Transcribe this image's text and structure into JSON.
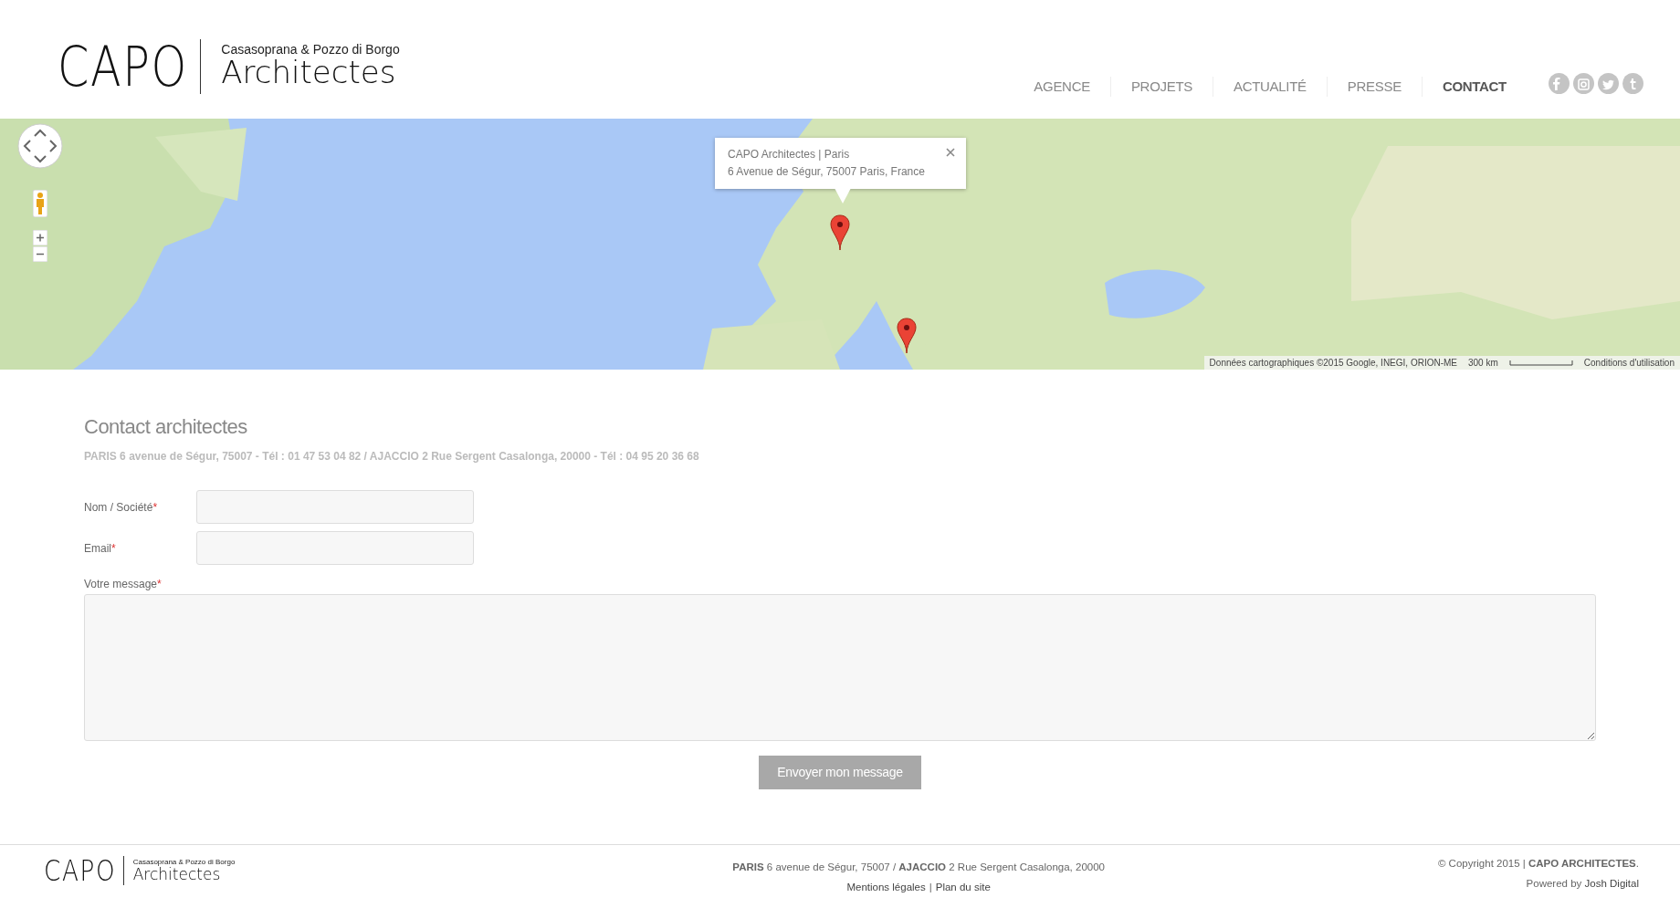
{
  "header": {
    "logo": {
      "mark": "CAPO",
      "subtitle": "Casasoprana & Pozzo di Borgo",
      "name": "Architectes"
    },
    "nav": [
      {
        "label": "AGENCE",
        "selected": false
      },
      {
        "label": "PROJETS",
        "selected": false
      },
      {
        "label": "ACTUALITÉ",
        "selected": false
      },
      {
        "label": "PRESSE",
        "selected": false
      },
      {
        "label": "CONTACT",
        "selected": true
      }
    ],
    "social": [
      {
        "kind": "facebook"
      },
      {
        "kind": "instagram"
      },
      {
        "kind": "twitter"
      },
      {
        "kind": "tumblr"
      }
    ]
  },
  "map": {
    "kind": "picture",
    "info_window": {
      "title": "CAPO Architectes | Paris",
      "address": "6 Avenue de Ségur, 75007 Paris, France"
    },
    "attribution": "Données cartographiques ©2015 Google, INEGI, ORION-ME",
    "scale": "300 km",
    "terms": "Conditions d'utilisation"
  },
  "contact": {
    "title": "Contact architectes",
    "addresses": "PARIS 6 avenue de Ségur, 75007 - Tél : 01 47 53 04 82 / AJACCIO 2 Rue Sergent Casalonga, 20000 - Tél : 04 95 20 36 68",
    "fields": [
      {
        "kind": "input",
        "label": "Nom / Société",
        "required_mark": "*"
      },
      {
        "kind": "input",
        "label": "Email",
        "required_mark": "*"
      },
      {
        "kind": "textarea",
        "label": "Votre message",
        "required_mark": "*"
      }
    ],
    "submit": "Envoyer mon message"
  },
  "footer": {
    "logo": {
      "mark": "CAPO",
      "subtitle": "Casasoprana & Pozzo di Borgo",
      "name": "Architectes"
    },
    "address": "**PARIS** 6 avenue de Ségur, 75007 / **AJACCIO** 2 Rue Sergent Casalonga, 20000",
    "links": [
      "Mentions légales",
      "Plan du site"
    ],
    "link_separator": "|",
    "copyright": "© Copyright 2015 | **CAPO ARCHITECTES**.",
    "powered_by": "Powered by",
    "powered_link": "Josh Digital"
  }
}
